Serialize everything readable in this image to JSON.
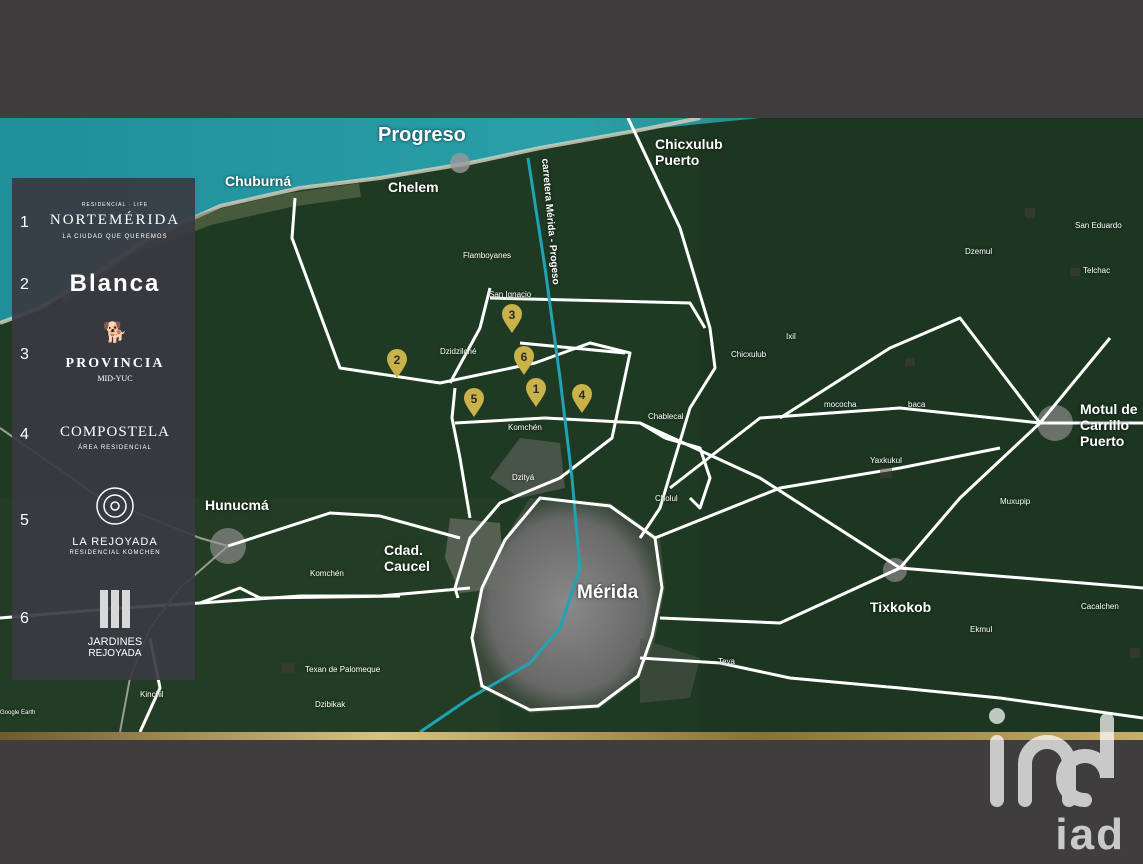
{
  "map": {
    "cities": {
      "progreso": "Progreso",
      "chicxulub_puerto": "Chicxulub\nPuerto",
      "chuburna": "Chuburná",
      "chelem": "Chelem",
      "hunucma": "Hunucmá",
      "cdad_caucel": "Cdad.\nCaucel",
      "merida": "Mérida",
      "tixkokob": "Tixkokob",
      "motul": "Motul de\nCarrillo\nPuerto"
    },
    "towns": {
      "flamboyanes": "Flamboyanes",
      "san_ignacio": "San Ignacio",
      "dzidzilche": "Dzidzilché",
      "komchen": "Komchén",
      "dzitya": "Dzityá",
      "chablecal": "Chablecal",
      "cholul": "Cholul",
      "chicxulub": "Chicxulub",
      "ixil": "Ixil",
      "mococha": "mococha",
      "baca": "baca",
      "yaxkukul": "Yaxkukul",
      "muxupip": "Muxupip",
      "ekmul": "Ekmul",
      "cacalchen": "Cacalchen",
      "teya": "Teya",
      "dzemul": "Dzemul",
      "san_eduardo": "San Eduardo",
      "telchac": "Telchac",
      "komchen_west": "Komchén",
      "texan": "Texan de Palomeque",
      "dzibikak": "Dzibikak",
      "kinchil": "Kinchil",
      "google_earth": "Google Earth"
    },
    "road_label": "carretera Mérida - Progeso",
    "pins": [
      "1",
      "2",
      "3",
      "4",
      "5",
      "6"
    ]
  },
  "legend": {
    "items": [
      {
        "num": "1",
        "title": "NORTEMÉRIDA",
        "sub": "LA CIUDAD QUE QUEREMOS",
        "top": "RESIDENCIAL · LIFE"
      },
      {
        "num": "2",
        "title": "Blanca"
      },
      {
        "num": "3",
        "title": "PROVINCIA",
        "sub": "MID-YUC"
      },
      {
        "num": "4",
        "title": "COMPOSTELA",
        "sub": "ÁREA RESIDENCIAL"
      },
      {
        "num": "5",
        "title": "LA REJOYADA",
        "sub": "RESIDENCIAL KOMCHEN"
      },
      {
        "num": "6",
        "title": "JARDINES",
        "sub": "REJOYADA"
      }
    ]
  },
  "watermark": {
    "brand": "iad"
  },
  "colors": {
    "background": "#403d3e",
    "pin": "#c9b24a",
    "road": "#ffffff",
    "highway": "#1fa3b5",
    "gold": "#c7ae6d"
  }
}
